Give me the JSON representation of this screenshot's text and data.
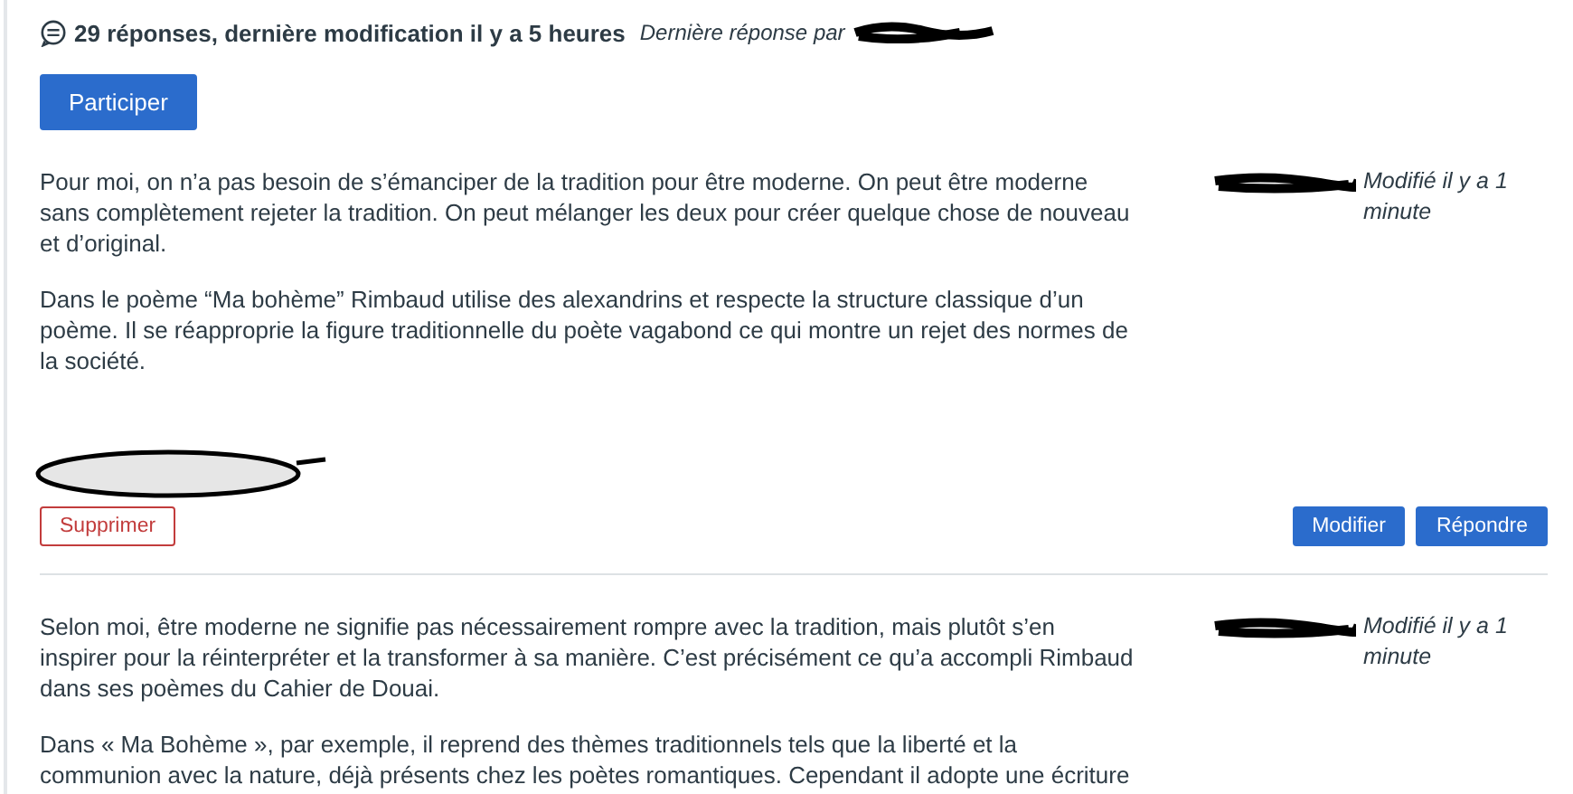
{
  "thread": {
    "summary": "29 réponses, dernière modification il y a 5 heures",
    "last_reply": "Dernière réponse par",
    "join_button": "Participer"
  },
  "posts": [
    {
      "paragraphs": [
        " Pour moi, on n’a pas besoin de s’émanciper de la tradition pour être moderne. On peut être moderne sans complètement rejeter la tradition. On peut mélanger les deux pour créer quelque chose de nouveau et d’original.",
        "Dans le poème “Ma bohème” Rimbaud utilise des alexandrins et respecte la structure classique d’un poème. Il se réapproprie la figure traditionnelle du poète vagabond ce qui montre un rejet des normes de la société."
      ],
      "meta": "Modifié il y a 1 minute",
      "actions": [
        {
          "label": "Supprimer",
          "kind": "danger"
        },
        {
          "label": "Modifier",
          "kind": "primary"
        },
        {
          "label": "Répondre",
          "kind": "primary"
        }
      ]
    },
    {
      "paragraphs": [
        "Selon moi, être moderne ne signifie pas nécessairement rompre avec la tradition, mais plutôt s’en inspirer pour la réinterpréter et la transformer à sa manière. C’est précisément ce qu’a accompli Rimbaud dans ses poèmes du Cahier de Douai.",
        "Dans « Ma Bohème », par exemple, il reprend des thèmes traditionnels tels que la liberté et la communion avec la nature, déjà présents chez les poètes romantiques. Cependant il adopte une écriture"
      ],
      "meta": "Modifié il y a 1 minute"
    }
  ]
}
